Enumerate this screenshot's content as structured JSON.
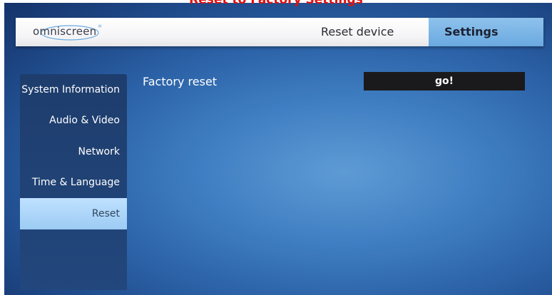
{
  "caption": "Reset to Factory Settings",
  "header": {
    "logo_text": "omniscreen",
    "crumb": "Reset device",
    "active_tab": "Settings"
  },
  "sidebar": {
    "items": [
      {
        "label": "System Information",
        "active": false
      },
      {
        "label": "Audio & Video",
        "active": false
      },
      {
        "label": "Network",
        "active": false
      },
      {
        "label": "Time & Language",
        "active": false
      },
      {
        "label": "Reset",
        "active": true
      }
    ]
  },
  "main": {
    "setting_label": "Factory reset",
    "action_label": "go!"
  },
  "colors": {
    "caption": "#e01010",
    "tab_highlight": "#6aa9e0",
    "sidebar_bg": "#1e3d6d",
    "sidebar_active": "#bfe1ff",
    "button_bg": "#1a1a1c"
  }
}
